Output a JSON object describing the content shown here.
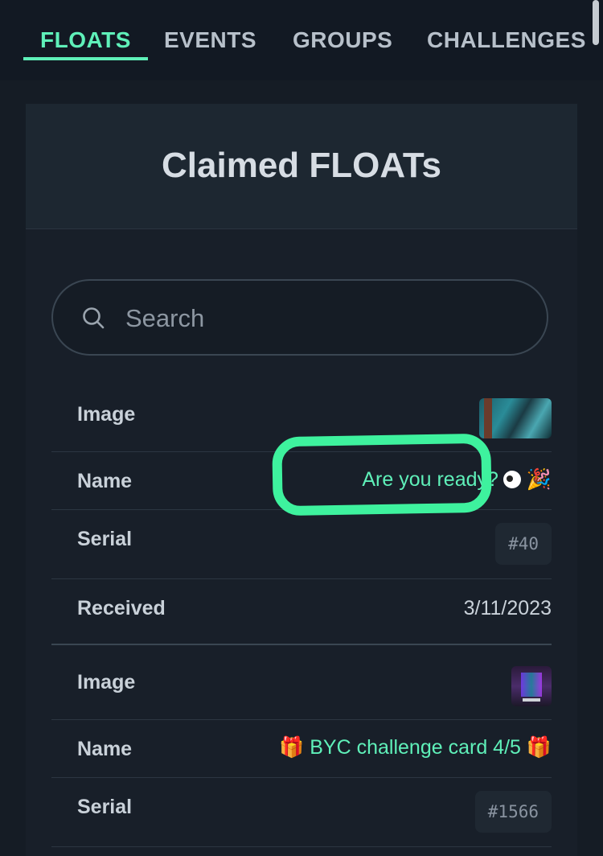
{
  "tabs": [
    {
      "label": "FLOATS",
      "active": true
    },
    {
      "label": "EVENTS",
      "active": false
    },
    {
      "label": "GROUPS",
      "active": false
    },
    {
      "label": "CHALLENGES",
      "active": false
    }
  ],
  "card": {
    "title": "Claimed FLOATs"
  },
  "search": {
    "placeholder": "Search",
    "value": ""
  },
  "floats": [
    {
      "image_label": "Image",
      "name_label": "Name",
      "name": "Are you ready?",
      "name_suffix_emoji": "🎉",
      "serial_label": "Serial",
      "serial": "#40",
      "received_label": "Received",
      "received": "3/11/2023"
    },
    {
      "image_label": "Image",
      "name_label": "Name",
      "name": "🎁 BYC challenge card 4/5 🎁",
      "serial_label": "Serial",
      "serial": "#1566"
    }
  ],
  "colors": {
    "accent": "#5ff0b9",
    "highlight_annotation": "#3ef29e",
    "background": "#151c25"
  }
}
